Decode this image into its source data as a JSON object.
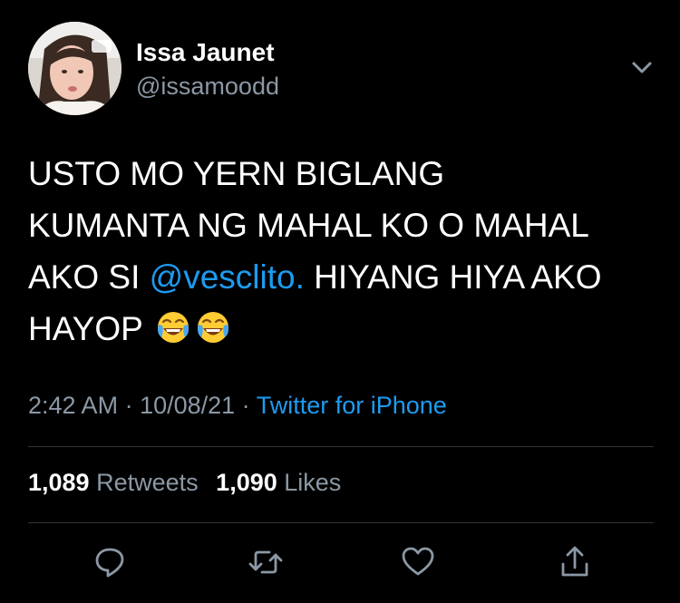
{
  "tweet": {
    "author": {
      "display_name": "Issa Jaunet",
      "handle": "@issamoodd"
    },
    "text": {
      "line1": "USTO MO YERN  BIGLANG",
      "line2": "KUMANTA NG MAHAL KO O MAHAL",
      "line3_prefix": "AKO SI ",
      "mention": "@vesclito.",
      "line3_suffix": " HIYANG HIYA AKO",
      "line4": "HAYOP",
      "emojis": [
        "face-with-tears-of-joy",
        "face-with-tears-of-joy"
      ]
    },
    "meta": {
      "time": "2:42 AM",
      "sep1": " · ",
      "date": "10/08/21",
      "sep2": " · ",
      "source": "Twitter for iPhone"
    },
    "stats": {
      "retweets_count": "1,089",
      "retweets_label": "Retweets",
      "likes_count": "1,090",
      "likes_label": "Likes"
    },
    "actions": [
      "reply-icon",
      "retweet-icon",
      "like-icon",
      "share-icon"
    ]
  },
  "colors": {
    "background": "#000000",
    "text": "#ffffff",
    "secondary": "#8b98a5",
    "link": "#1d9bf0",
    "divider": "#2f3336"
  }
}
